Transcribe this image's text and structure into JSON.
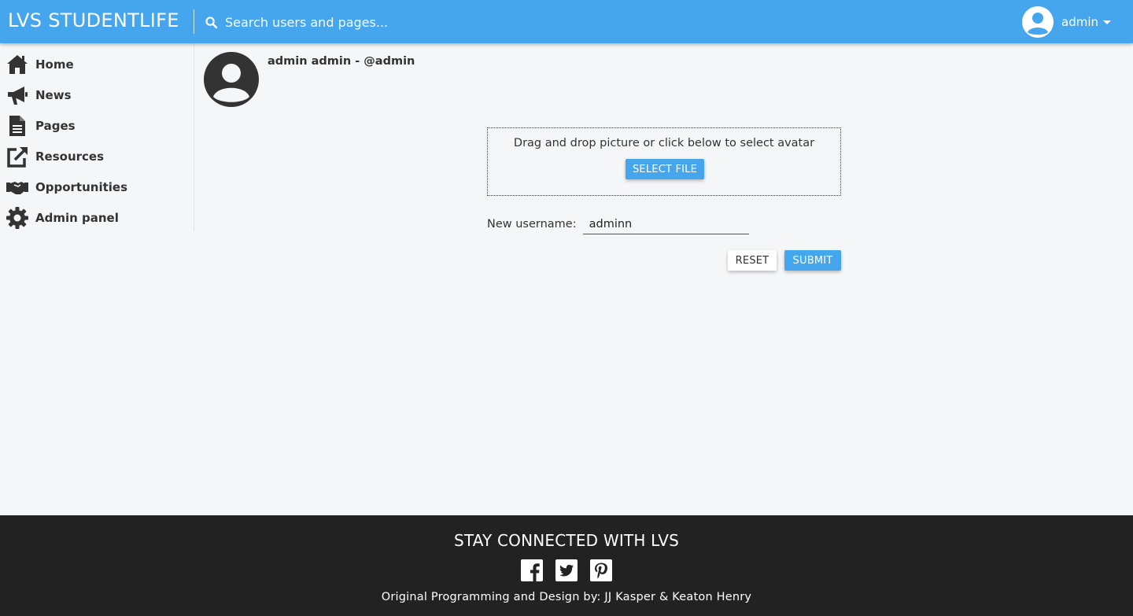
{
  "header": {
    "brand": "LVS STUDENTLIFE",
    "search_placeholder": "Search users and pages...",
    "search_icon": "search-icon",
    "user_name": "admin",
    "user_icon": "user-circle-icon",
    "caret_icon": "caret-down-icon",
    "accent_color": "#45a6ee"
  },
  "sidebar": {
    "items": [
      {
        "label": "Home",
        "icon": "home-icon"
      },
      {
        "label": "News",
        "icon": "megaphone-icon"
      },
      {
        "label": "Pages",
        "icon": "file-icon"
      },
      {
        "label": "Resources",
        "icon": "external-link-icon"
      },
      {
        "label": "Opportunities",
        "icon": "handshake-icon"
      },
      {
        "label": "Admin panel",
        "icon": "gear-icon"
      }
    ]
  },
  "profile": {
    "display": "admin admin - @admin",
    "avatar_icon": "user-circle-icon"
  },
  "avatar_upload": {
    "instruction": "Drag and drop picture or click below to select avatar",
    "select_label": "SELECT FILE"
  },
  "username_form": {
    "label": "New username:",
    "value": "adminn",
    "reset_label": "RESET",
    "submit_label": "SUBMIT"
  },
  "footer": {
    "title": "STAY CONNECTED WITH LVS",
    "social": [
      "facebook-icon",
      "twitter-icon",
      "pinterest-icon"
    ],
    "credits": "Original Programming and Design by: JJ Kasper & Keaton Henry",
    "background": "#222222"
  }
}
